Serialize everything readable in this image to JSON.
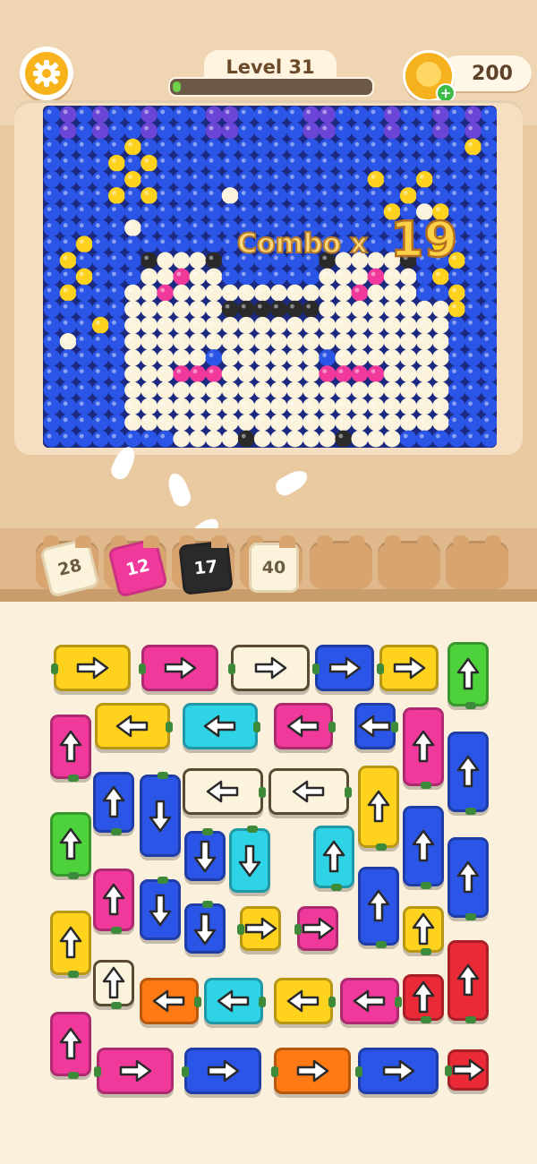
{
  "header": {
    "level_label": "Level 31",
    "progress_fraction": 0.04,
    "coins": "200",
    "settings_icon": "gear-icon",
    "coin_icon": "paw-coin-icon",
    "add_coin_icon": "plus-icon"
  },
  "combo": {
    "label": "Combo x",
    "value": "19"
  },
  "colors": {
    "blue": "#2a55e6",
    "yellow": "#ffd21e",
    "pink": "#f0399b",
    "cyan": "#2ed3e6",
    "green": "#4dd23c",
    "cream": "#fcf3dd",
    "red": "#ea2b37",
    "orange": "#ff7a14",
    "black": "#2a2a2a",
    "purple": "#6a45d6"
  },
  "slots": [
    {
      "count": "28",
      "color": "cream"
    },
    {
      "count": "12",
      "color": "pink"
    },
    {
      "count": "17",
      "color": "black"
    },
    {
      "count": "40",
      "color": "cream"
    },
    {
      "count": "",
      "color": ""
    },
    {
      "count": "",
      "color": ""
    },
    {
      "count": "",
      "color": ""
    }
  ],
  "arrow_blocks": [
    {
      "color": "yellow",
      "dir": "right"
    },
    {
      "color": "pink",
      "dir": "right"
    },
    {
      "color": "cream",
      "dir": "right"
    },
    {
      "color": "blue",
      "dir": "right"
    },
    {
      "color": "yellow",
      "dir": "right"
    },
    {
      "color": "green",
      "dir": "up"
    },
    {
      "color": "pink",
      "dir": "up"
    },
    {
      "color": "yellow",
      "dir": "left"
    },
    {
      "color": "cyan",
      "dir": "left"
    },
    {
      "color": "pink",
      "dir": "left"
    },
    {
      "color": "blue",
      "dir": "left"
    },
    {
      "color": "pink",
      "dir": "up"
    },
    {
      "color": "blue",
      "dir": "up"
    },
    {
      "color": "blue",
      "dir": "up"
    },
    {
      "color": "blue",
      "dir": "down"
    },
    {
      "color": "cream",
      "dir": "left"
    },
    {
      "color": "cream",
      "dir": "left"
    },
    {
      "color": "yellow",
      "dir": "up"
    },
    {
      "color": "green",
      "dir": "up"
    },
    {
      "color": "blue",
      "dir": "down"
    },
    {
      "color": "cyan",
      "dir": "down"
    },
    {
      "color": "cyan",
      "dir": "up"
    },
    {
      "color": "blue",
      "dir": "up"
    },
    {
      "color": "blue",
      "dir": "up"
    },
    {
      "color": "pink",
      "dir": "up"
    },
    {
      "color": "blue",
      "dir": "down"
    },
    {
      "color": "blue",
      "dir": "down"
    },
    {
      "color": "yellow",
      "dir": "right"
    },
    {
      "color": "pink",
      "dir": "right"
    },
    {
      "color": "blue",
      "dir": "up"
    },
    {
      "color": "yellow",
      "dir": "up"
    },
    {
      "color": "yellow",
      "dir": "up"
    },
    {
      "color": "cream",
      "dir": "up"
    },
    {
      "color": "orange",
      "dir": "left"
    },
    {
      "color": "cyan",
      "dir": "left"
    },
    {
      "color": "yellow",
      "dir": "left"
    },
    {
      "color": "pink",
      "dir": "left"
    },
    {
      "color": "red",
      "dir": "up"
    },
    {
      "color": "red",
      "dir": "up"
    },
    {
      "color": "pink",
      "dir": "up"
    },
    {
      "color": "pink",
      "dir": "right"
    },
    {
      "color": "blue",
      "dir": "right"
    },
    {
      "color": "orange",
      "dir": "right"
    },
    {
      "color": "blue",
      "dir": "right"
    },
    {
      "color": "red",
      "dir": "right"
    }
  ]
}
